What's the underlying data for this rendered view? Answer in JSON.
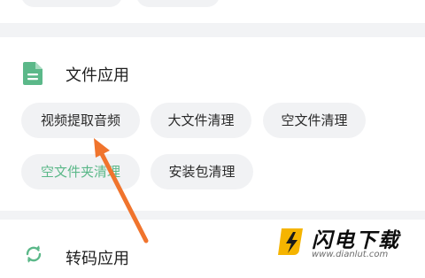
{
  "top_chips": [
    {
      "label": ""
    },
    {
      "label": ""
    }
  ],
  "file_apps": {
    "title": "文件应用",
    "icon": "document-icon",
    "icon_color": "#5bb889",
    "chips": [
      {
        "label": "视频提取音频"
      },
      {
        "label": "大文件清理"
      },
      {
        "label": "空文件清理"
      },
      {
        "label": "空文件夹清理",
        "highlighted": true
      },
      {
        "label": "安装包清理"
      }
    ]
  },
  "convert_apps": {
    "title": "转码应用",
    "icon": "sync-icon",
    "icon_color": "#5bb889"
  },
  "annotation": {
    "arrow_color": "#f0742d"
  },
  "watermark": {
    "name": "闪电下载",
    "url": "www.dianlut.com",
    "logo_color": "#f5b400"
  }
}
